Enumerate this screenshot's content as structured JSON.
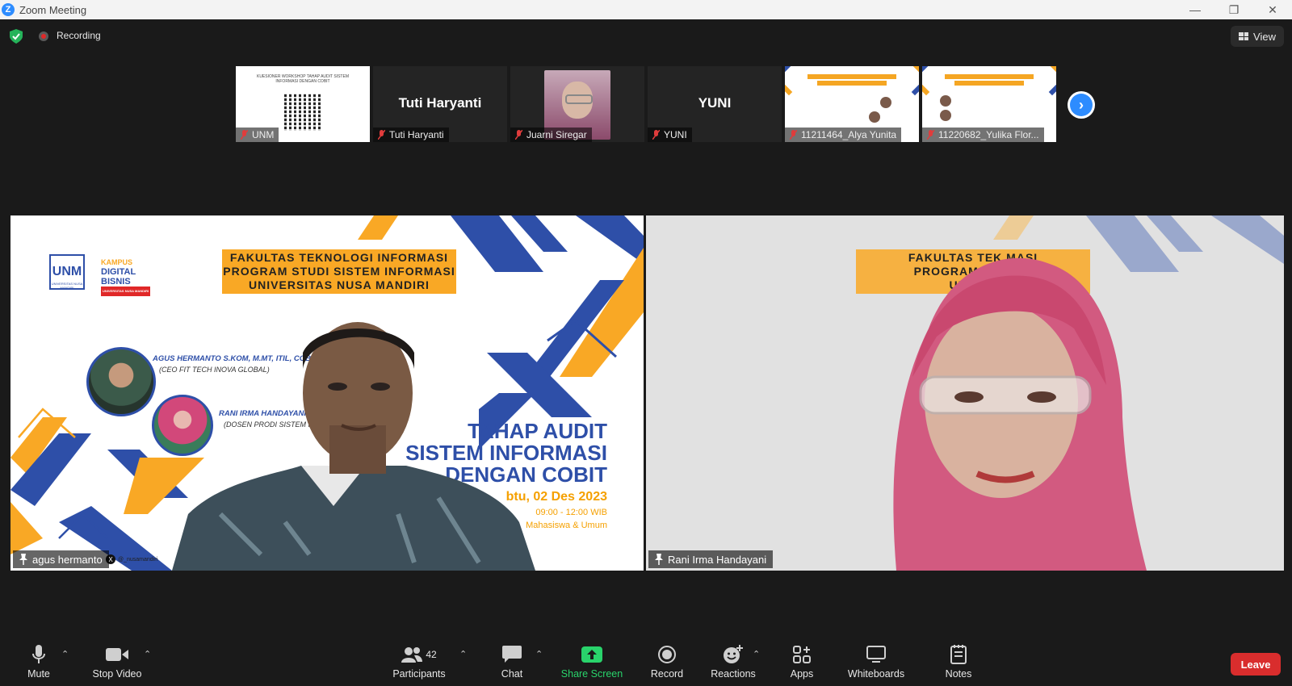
{
  "window": {
    "title": "Zoom Meeting"
  },
  "topbar": {
    "recording_label": "Recording",
    "view_label": "View"
  },
  "thumbnails": [
    {
      "name": "UNM",
      "card_text": "KUESIONER WORKSHOP TAHAP AUDIT SISTEM INFORMASI DENGAN COBIT"
    },
    {
      "name": "Tuti Haryanti",
      "display": "Tuti Haryanti"
    },
    {
      "name": "Juarni Siregar"
    },
    {
      "name": "YUNI",
      "display": "YUNI"
    },
    {
      "name": "11211464_Alya Yunita"
    },
    {
      "name": "11220682_Yulika Flor..."
    }
  ],
  "main_left": {
    "name": "agus hermanto",
    "banner": [
      "FAKULTAS TEKNOLOGI INFORMASI",
      "PROGRAM STUDI SISTEM INFORMASI",
      "UNIVERSITAS NUSA MANDIRI"
    ],
    "logo_text": "UNM",
    "logo_sub": "UNIVERSITAS NUSA MANDIRI",
    "kdb_top": "KAMPUS",
    "kdb_l1": "DIGITAL",
    "kdb_l2": "BISNIS",
    "kdb_sub": "UNIVERSITAS NUSA MANDIRI",
    "speaker1_name": "AGUS HERMANTO S.KOM, M.MT, ITIL, COBIT, S",
    "speaker1_sub": "(CEO FIT TECH INOVA GLOBAL)",
    "speaker2_name": "RANI IRMA HANDAYANI, M",
    "speaker2_sub": "(DOSEN PRODI SISTEM IN",
    "headline": [
      "TAHAP AUDIT",
      "SISTEM INFORMASI",
      "DENGAN COBIT"
    ],
    "date": "btu, 02 Des 2023",
    "time": "09:00 - 12:00 WIB",
    "audience": "Mahasiswa & Umum",
    "social": "@_nusamandiri"
  },
  "main_right": {
    "name": "Rani Irma Handayani",
    "banner": [
      "FAKULTAS TEK          MASI",
      "PROGRAM STU          ASI",
      "UNIVER"
    ]
  },
  "toolbar": {
    "mute": "Mute",
    "video": "Stop Video",
    "participants": "Participants",
    "participants_count": "42",
    "chat": "Chat",
    "share": "Share Screen",
    "record": "Record",
    "reactions": "Reactions",
    "apps": "Apps",
    "whiteboards": "Whiteboards",
    "notes": "Notes",
    "leave": "Leave"
  },
  "colors": {
    "accent": "#2d8cff",
    "share_green": "#29d36b",
    "leave_red": "#d92d2d",
    "speaker_outline": "#c9e77c"
  }
}
